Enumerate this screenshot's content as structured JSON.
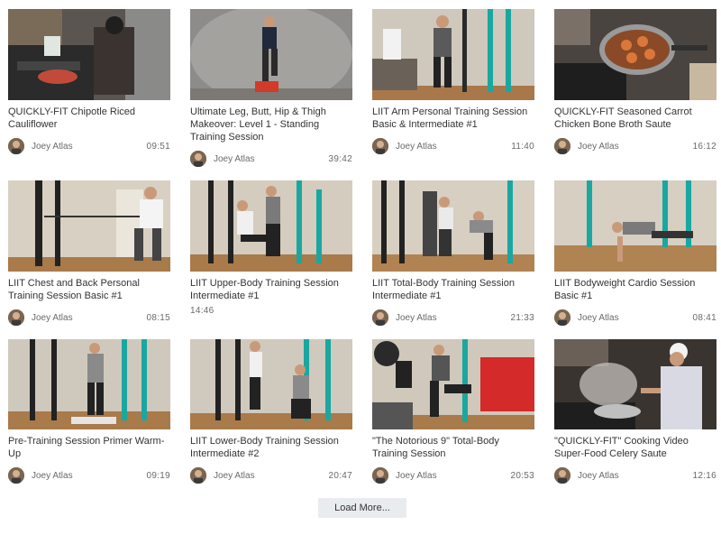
{
  "videos": [
    {
      "title": "QUICKLY-FIT Chipotle Riced Cauliflower",
      "author": "Joey Atlas",
      "duration": "09:51",
      "thumb_icon": "kitchen-cooking-scene"
    },
    {
      "title": "Ultimate Leg, Butt, Hip & Thigh Makeover: Level 1 - Standing Training Session",
      "author": "Joey Atlas",
      "duration": "39:42",
      "thumb_icon": "studio-step-exercise-scene"
    },
    {
      "title": "LIIT Arm Personal Training Session Basic & Intermediate #1",
      "author": "Joey Atlas",
      "duration": "11:40",
      "thumb_icon": "home-gym-band-scene"
    },
    {
      "title": "QUICKLY-FIT Seasoned Carrot Chicken Bone Broth Saute",
      "author": "Joey Atlas",
      "duration": "16:12",
      "thumb_icon": "frying-pan-carrots-scene"
    },
    {
      "title": "LIIT Chest and Back Personal Training Session Basic #1",
      "author": "Joey Atlas",
      "duration": "08:15",
      "thumb_icon": "resistance-band-press-scene"
    },
    {
      "title": "LIIT Upper-Body Training Session Intermediate #1",
      "author": "",
      "duration": "14:46",
      "thumb_icon": "partner-squat-scene"
    },
    {
      "title": "LIIT Total-Body Training Session Intermediate #1",
      "author": "Joey Atlas",
      "duration": "21:33",
      "thumb_icon": "partner-row-scene"
    },
    {
      "title": "LIIT Bodyweight Cardio Session Basic #1",
      "author": "Joey Atlas",
      "duration": "08:41",
      "thumb_icon": "floor-cardio-scene"
    },
    {
      "title": "Pre-Training Session Primer Warm-Up",
      "author": "Joey Atlas",
      "duration": "09:19",
      "thumb_icon": "warm-up-standing-scene"
    },
    {
      "title": "LIIT Lower-Body Training Session Intermediate #2",
      "author": "Joey Atlas",
      "duration": "20:47",
      "thumb_icon": "lower-body-partner-scene"
    },
    {
      "title": "\"The Notorious 9\" Total-Body Training Session",
      "author": "Joey Atlas",
      "duration": "20:53",
      "thumb_icon": "lunge-band-scene"
    },
    {
      "title": "\"QUICKLY-FIT\" Cooking Video Super-Food Celery Saute",
      "author": "Joey Atlas",
      "duration": "12:16",
      "thumb_icon": "steaming-pot-scene"
    }
  ],
  "load_more_label": "Load More...",
  "colors": {
    "text": "#333333",
    "meta": "#6a6a6a",
    "button_bg": "#e9ecef",
    "rack_teal": "#1aa7a0"
  }
}
